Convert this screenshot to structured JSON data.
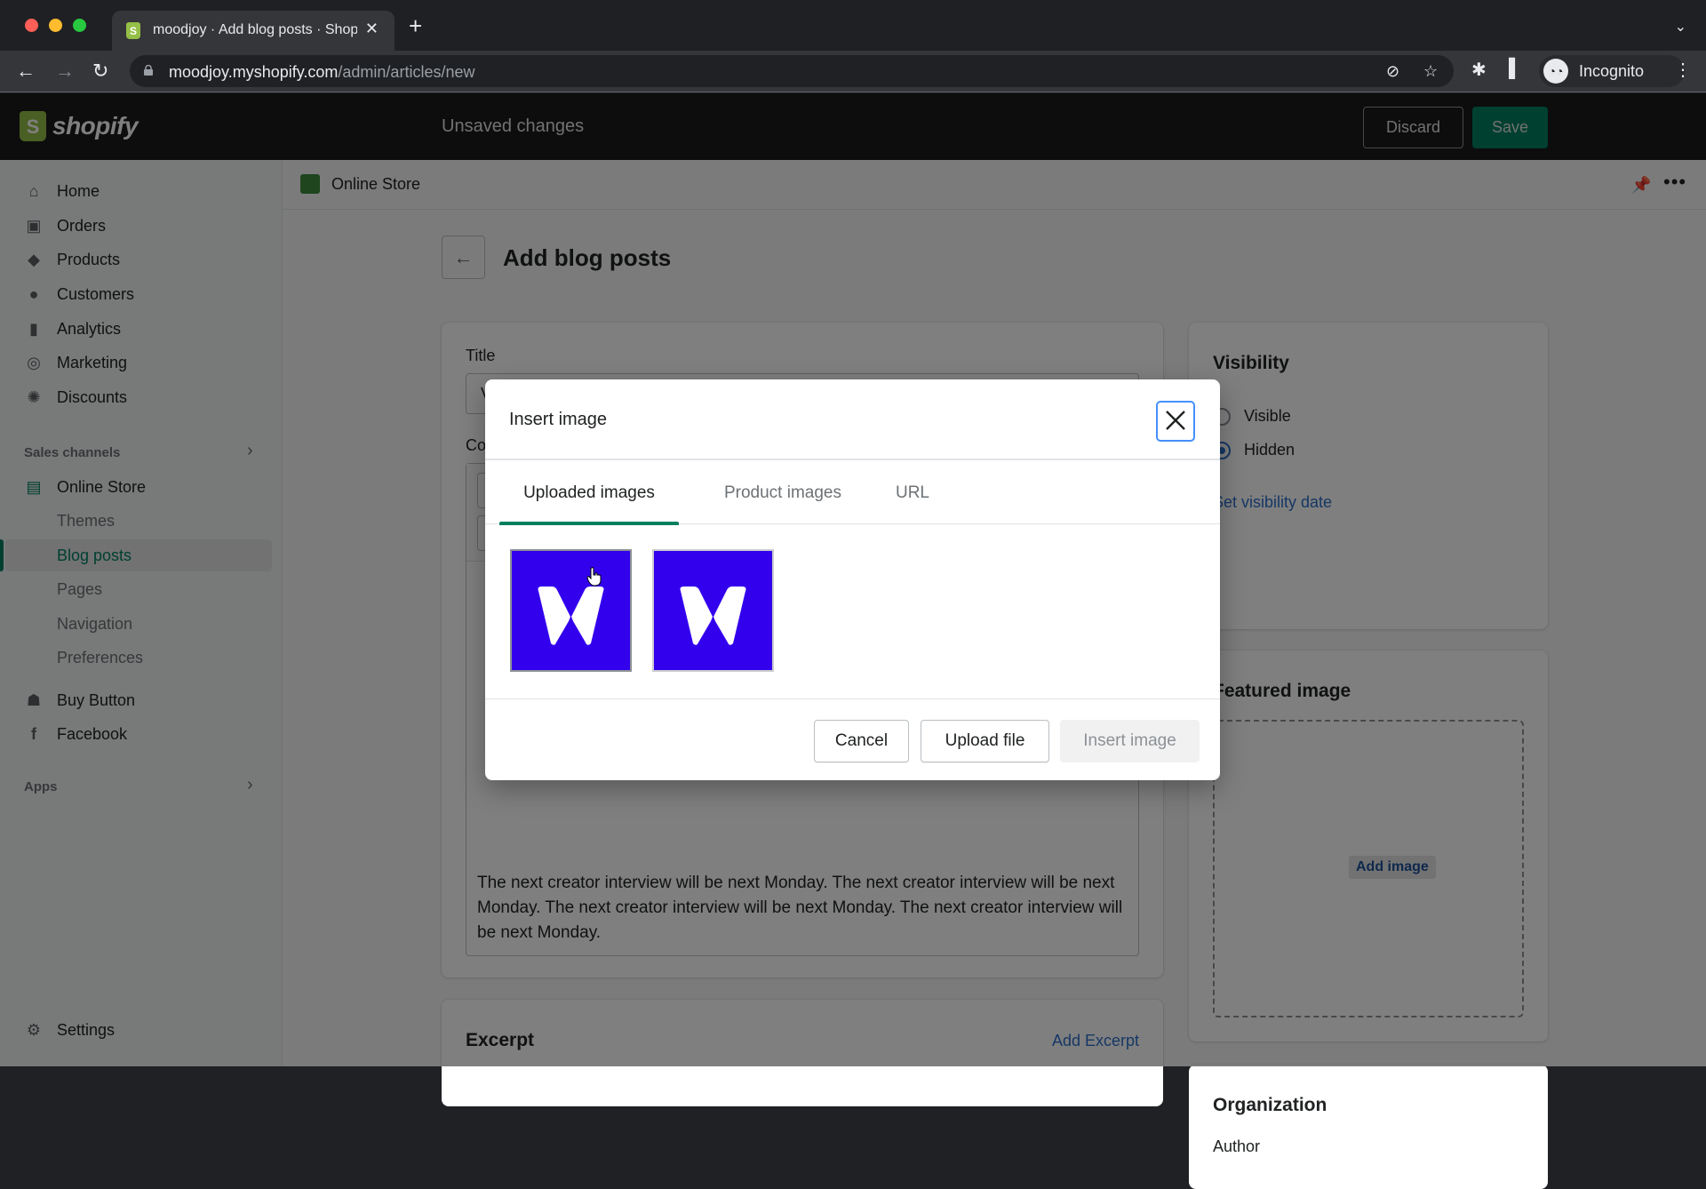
{
  "browser": {
    "tab_title": "moodjoy · Add blog posts · Shopify",
    "url_host": "moodjoy.myshopify.com",
    "url_path": "/admin/articles/new",
    "profile_label": "Incognito",
    "icons": [
      "back-icon",
      "forward-icon",
      "reload-icon",
      "lock-icon",
      "eye-off-icon",
      "star-icon",
      "extensions-icon",
      "side-panel-icon",
      "incognito-icon",
      "menu-icon"
    ]
  },
  "topbar": {
    "logo_text": "shopify",
    "status": "Unsaved changes",
    "discard_label": "Discard",
    "save_label": "Save",
    "save_color": "#008060"
  },
  "sidebar": {
    "items": [
      {
        "label": "Home",
        "icon": "home-icon"
      },
      {
        "label": "Orders",
        "icon": "orders-icon"
      },
      {
        "label": "Products",
        "icon": "tag-icon"
      },
      {
        "label": "Customers",
        "icon": "person-icon"
      },
      {
        "label": "Analytics",
        "icon": "bar-chart-icon"
      },
      {
        "label": "Marketing",
        "icon": "target-icon"
      },
      {
        "label": "Discounts",
        "icon": "discount-icon"
      }
    ],
    "sales_channels_label": "Sales channels",
    "online_store": {
      "label": "Online Store",
      "subitems": [
        "Themes",
        "Blog posts",
        "Pages",
        "Navigation",
        "Preferences"
      ],
      "active": "Blog posts"
    },
    "channels": [
      {
        "label": "Buy Button",
        "icon": "buy-button-icon"
      },
      {
        "label": "Facebook",
        "icon": "facebook-icon"
      }
    ],
    "apps_label": "Apps",
    "settings_label": "Settings"
  },
  "breadcrumb": {
    "label": "Online Store"
  },
  "page": {
    "title": "Add blog posts",
    "main_card": {
      "title_label": "Title",
      "title_value": "V",
      "content_label": "Content",
      "paragraph": "The next creator interview will be next Monday.  The next creator interview will be next Monday. The next creator interview will be next Monday. The next creator interview will be next Monday."
    },
    "excerpt": {
      "title": "Excerpt",
      "action": "Add Excerpt"
    },
    "visibility": {
      "title": "Visibility",
      "options": [
        "Visible",
        "Hidden"
      ],
      "selected": "Hidden",
      "set_date_link": "Set visibility date"
    },
    "featured_image": {
      "title": "Featured image",
      "add_label": "Add image"
    },
    "organization": {
      "title": "Organization",
      "author_label": "Author"
    }
  },
  "modal": {
    "title": "Insert image",
    "tabs": [
      {
        "label": "Uploaded images",
        "active": true
      },
      {
        "label": "Product images",
        "active": false
      },
      {
        "label": "URL",
        "active": false
      }
    ],
    "images": [
      {
        "alt": "moodjoy logo image 1",
        "color": "#3300ee"
      },
      {
        "alt": "moodjoy logo image 2",
        "color": "#3300ee"
      }
    ],
    "cancel_label": "Cancel",
    "upload_label": "Upload file",
    "insert_label": "Insert image",
    "insert_disabled": true
  }
}
